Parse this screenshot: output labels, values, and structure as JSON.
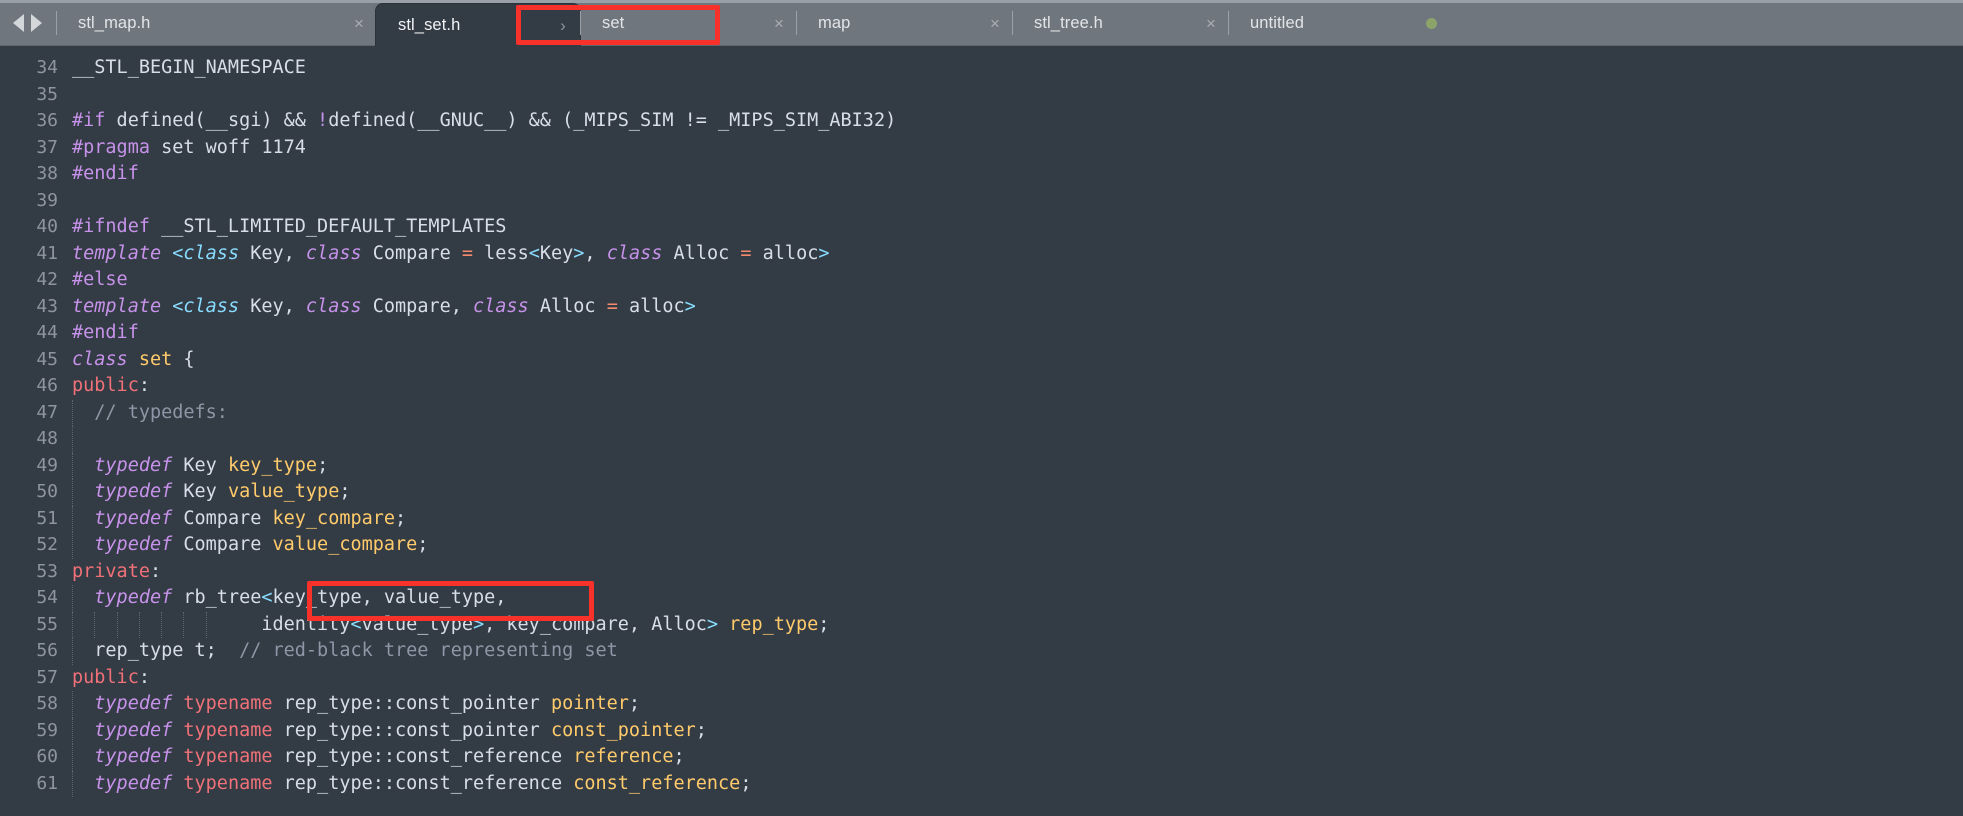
{
  "window": {
    "title": "stl_set.h",
    "background": "#333b45",
    "tabbar_background": "#70767e",
    "annotation_color": "#f8312a"
  },
  "nav": {
    "back_icon": "arrow-left-icon",
    "forward_icon": "arrow-right-icon"
  },
  "tabs": [
    {
      "label": "stl_map.h",
      "active": false,
      "close": "×",
      "trailing": "close"
    },
    {
      "label": "stl_set.h",
      "active": true,
      "chevron": "›",
      "trailing": "chevron"
    },
    {
      "label": "set",
      "active": false,
      "close": "×",
      "trailing": "close"
    },
    {
      "label": "map",
      "active": false,
      "close": "×",
      "trailing": "close"
    },
    {
      "label": "stl_tree.h",
      "active": false,
      "close": "×",
      "trailing": "close"
    },
    {
      "label": "untitled",
      "active": false,
      "trailing": "dot",
      "dot_color": "#8ca36a"
    }
  ],
  "annotations": [
    {
      "name": "highlight-active-tab",
      "target": "stl_set.h tab",
      "color": "#f8312a"
    },
    {
      "name": "highlight-template-args",
      "target": "<key_type, value_type,",
      "color": "#f8312a"
    }
  ],
  "editor": {
    "first_line": 34,
    "last_line": 61,
    "lines": [
      {
        "n": "34",
        "indent": 0,
        "tokens": [
          {
            "t": "__STL_BEGIN_NAMESPACE",
            "c": "plain"
          }
        ]
      },
      {
        "n": "35",
        "indent": 0,
        "tokens": []
      },
      {
        "n": "36",
        "indent": 0,
        "tokens": [
          {
            "t": "#if",
            "c": "pre"
          },
          {
            "t": " defined(__sgi) && ",
            "c": "plain"
          },
          {
            "t": "!",
            "c": "pre"
          },
          {
            "t": "defined(__GNUC__) && (_MIPS_SIM != _MIPS_SIM_ABI32)",
            "c": "plain"
          }
        ]
      },
      {
        "n": "37",
        "indent": 0,
        "tokens": [
          {
            "t": "#pragma",
            "c": "pre"
          },
          {
            "t": " set woff 1174",
            "c": "plain"
          }
        ]
      },
      {
        "n": "38",
        "indent": 0,
        "tokens": [
          {
            "t": "#endif",
            "c": "pre"
          }
        ]
      },
      {
        "n": "39",
        "indent": 0,
        "tokens": []
      },
      {
        "n": "40",
        "indent": 0,
        "tokens": [
          {
            "t": "#ifndef",
            "c": "pre"
          },
          {
            "t": " __STL_LIMITED_DEFAULT_TEMPLATES",
            "c": "plain"
          }
        ]
      },
      {
        "n": "41",
        "indent": 0,
        "tokens": [
          {
            "t": "template",
            "c": "kw"
          },
          {
            "t": " ",
            "c": "plain"
          },
          {
            "t": "<",
            "c": "punct"
          },
          {
            "t": "class",
            "c": "cls"
          },
          {
            "t": " Key, ",
            "c": "plain"
          },
          {
            "t": "class",
            "c": "kw"
          },
          {
            "t": " Compare ",
            "c": "plain"
          },
          {
            "t": "=",
            "c": "op"
          },
          {
            "t": " less",
            "c": "plain"
          },
          {
            "t": "<",
            "c": "punct"
          },
          {
            "t": "Key",
            "c": "plain"
          },
          {
            "t": ">",
            "c": "punct"
          },
          {
            "t": ", ",
            "c": "plain"
          },
          {
            "t": "class",
            "c": "kw"
          },
          {
            "t": " Alloc ",
            "c": "plain"
          },
          {
            "t": "=",
            "c": "op"
          },
          {
            "t": " alloc",
            "c": "plain"
          },
          {
            "t": ">",
            "c": "punct"
          }
        ]
      },
      {
        "n": "42",
        "indent": 0,
        "tokens": [
          {
            "t": "#else",
            "c": "pre"
          }
        ]
      },
      {
        "n": "43",
        "indent": 0,
        "tokens": [
          {
            "t": "template",
            "c": "kw"
          },
          {
            "t": " ",
            "c": "plain"
          },
          {
            "t": "<",
            "c": "punct"
          },
          {
            "t": "class",
            "c": "cls"
          },
          {
            "t": " Key, ",
            "c": "plain"
          },
          {
            "t": "class",
            "c": "kw"
          },
          {
            "t": " Compare, ",
            "c": "plain"
          },
          {
            "t": "class",
            "c": "kw"
          },
          {
            "t": " Alloc ",
            "c": "plain"
          },
          {
            "t": "=",
            "c": "op"
          },
          {
            "t": " alloc",
            "c": "plain"
          },
          {
            "t": ">",
            "c": "punct"
          }
        ]
      },
      {
        "n": "44",
        "indent": 0,
        "tokens": [
          {
            "t": "#endif",
            "c": "pre"
          }
        ]
      },
      {
        "n": "45",
        "indent": 0,
        "tokens": [
          {
            "t": "class",
            "c": "kw"
          },
          {
            "t": " ",
            "c": "plain"
          },
          {
            "t": "set",
            "c": "type"
          },
          {
            "t": " {",
            "c": "plain"
          }
        ]
      },
      {
        "n": "46",
        "indent": 0,
        "tokens": [
          {
            "t": "public",
            "c": "kw2"
          },
          {
            "t": ":",
            "c": "plain"
          }
        ]
      },
      {
        "n": "47",
        "indent": 1,
        "tokens": [
          {
            "t": "  // typedefs:",
            "c": "cmt"
          }
        ]
      },
      {
        "n": "48",
        "indent": 1,
        "tokens": []
      },
      {
        "n": "49",
        "indent": 1,
        "tokens": [
          {
            "t": "  ",
            "c": "plain"
          },
          {
            "t": "typedef",
            "c": "kw"
          },
          {
            "t": " Key ",
            "c": "plain"
          },
          {
            "t": "key_type",
            "c": "type"
          },
          {
            "t": ";",
            "c": "plain"
          }
        ]
      },
      {
        "n": "50",
        "indent": 1,
        "tokens": [
          {
            "t": "  ",
            "c": "plain"
          },
          {
            "t": "typedef",
            "c": "kw"
          },
          {
            "t": " Key ",
            "c": "plain"
          },
          {
            "t": "value_type",
            "c": "type"
          },
          {
            "t": ";",
            "c": "plain"
          }
        ]
      },
      {
        "n": "51",
        "indent": 1,
        "tokens": [
          {
            "t": "  ",
            "c": "plain"
          },
          {
            "t": "typedef",
            "c": "kw"
          },
          {
            "t": " Compare ",
            "c": "plain"
          },
          {
            "t": "key_compare",
            "c": "type"
          },
          {
            "t": ";",
            "c": "plain"
          }
        ]
      },
      {
        "n": "52",
        "indent": 1,
        "tokens": [
          {
            "t": "  ",
            "c": "plain"
          },
          {
            "t": "typedef",
            "c": "kw"
          },
          {
            "t": " Compare ",
            "c": "plain"
          },
          {
            "t": "value_compare",
            "c": "type"
          },
          {
            "t": ";",
            "c": "plain"
          }
        ]
      },
      {
        "n": "53",
        "indent": 0,
        "tokens": [
          {
            "t": "private",
            "c": "kw2"
          },
          {
            "t": ":",
            "c": "plain"
          }
        ]
      },
      {
        "n": "54",
        "indent": 1,
        "tokens": [
          {
            "t": "  ",
            "c": "plain"
          },
          {
            "t": "typedef",
            "c": "kw"
          },
          {
            "t": " rb_tree",
            "c": "plain"
          },
          {
            "t": "<",
            "c": "punct"
          },
          {
            "t": "key_type, value_type,",
            "c": "plain"
          }
        ]
      },
      {
        "n": "55",
        "indent": 7,
        "tokens": [
          {
            "t": "                 identity",
            "c": "plain"
          },
          {
            "t": "<",
            "c": "punct"
          },
          {
            "t": "value_type",
            "c": "plain"
          },
          {
            "t": ">",
            "c": "punct"
          },
          {
            "t": ", key_compare, Alloc",
            "c": "plain"
          },
          {
            "t": ">",
            "c": "punct"
          },
          {
            "t": " ",
            "c": "plain"
          },
          {
            "t": "rep_type",
            "c": "type"
          },
          {
            "t": ";",
            "c": "plain"
          }
        ]
      },
      {
        "n": "56",
        "indent": 1,
        "tokens": [
          {
            "t": "  rep_type t;  ",
            "c": "plain"
          },
          {
            "t": "// red-black tree representing set",
            "c": "cmt"
          }
        ]
      },
      {
        "n": "57",
        "indent": 0,
        "tokens": [
          {
            "t": "public",
            "c": "kw2"
          },
          {
            "t": ":",
            "c": "plain"
          }
        ]
      },
      {
        "n": "58",
        "indent": 1,
        "tokens": [
          {
            "t": "  ",
            "c": "plain"
          },
          {
            "t": "typedef",
            "c": "kw"
          },
          {
            "t": " ",
            "c": "plain"
          },
          {
            "t": "typename",
            "c": "kw2"
          },
          {
            "t": " rep_type::const_pointer ",
            "c": "plain"
          },
          {
            "t": "pointer",
            "c": "type"
          },
          {
            "t": ";",
            "c": "plain"
          }
        ]
      },
      {
        "n": "59",
        "indent": 1,
        "tokens": [
          {
            "t": "  ",
            "c": "plain"
          },
          {
            "t": "typedef",
            "c": "kw"
          },
          {
            "t": " ",
            "c": "plain"
          },
          {
            "t": "typename",
            "c": "kw2"
          },
          {
            "t": " rep_type::const_pointer ",
            "c": "plain"
          },
          {
            "t": "const_pointer",
            "c": "type"
          },
          {
            "t": ";",
            "c": "plain"
          }
        ]
      },
      {
        "n": "60",
        "indent": 1,
        "tokens": [
          {
            "t": "  ",
            "c": "plain"
          },
          {
            "t": "typedef",
            "c": "kw"
          },
          {
            "t": " ",
            "c": "plain"
          },
          {
            "t": "typename",
            "c": "kw2"
          },
          {
            "t": " rep_type::const_reference ",
            "c": "plain"
          },
          {
            "t": "reference",
            "c": "type"
          },
          {
            "t": ";",
            "c": "plain"
          }
        ]
      },
      {
        "n": "61",
        "indent": 1,
        "tokens": [
          {
            "t": "  ",
            "c": "plain"
          },
          {
            "t": "typedef",
            "c": "kw"
          },
          {
            "t": " ",
            "c": "plain"
          },
          {
            "t": "typename",
            "c": "kw2"
          },
          {
            "t": " rep_type::const_reference ",
            "c": "plain"
          },
          {
            "t": "const_reference",
            "c": "type"
          },
          {
            "t": ";",
            "c": "plain"
          }
        ]
      }
    ]
  }
}
